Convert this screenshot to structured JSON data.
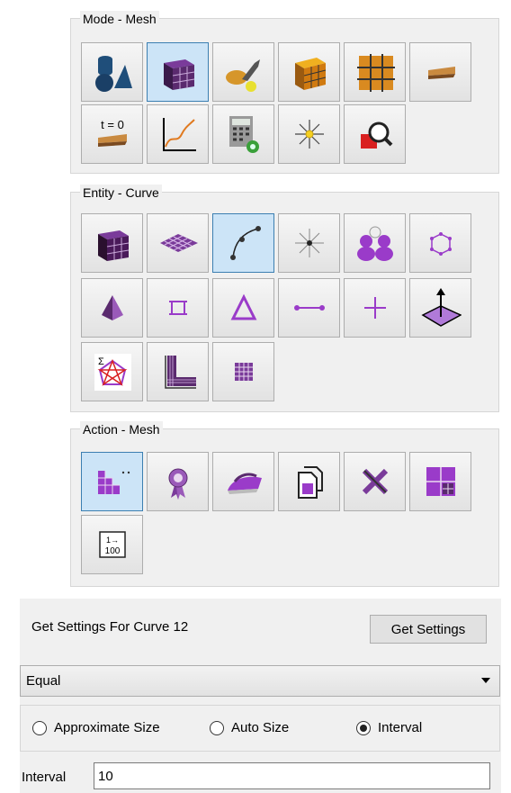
{
  "mode_group": {
    "title": "Mode - Mesh",
    "buttons": [
      {
        "icon": "geometry-icon"
      },
      {
        "icon": "mesh-cube-icon",
        "selected": true
      },
      {
        "icon": "boundary-conditions-icon"
      },
      {
        "icon": "material-cube-icon"
      },
      {
        "icon": "grid-icon"
      },
      {
        "icon": "analysis-icon"
      },
      {
        "icon": "initial-condition-icon",
        "label": "t = 0"
      },
      {
        "icon": "graph-icon"
      },
      {
        "icon": "calculator-icon"
      },
      {
        "icon": "sparkle-icon"
      },
      {
        "icon": "magnify-icon"
      }
    ]
  },
  "entity_group": {
    "title": "Entity - Curve",
    "buttons": [
      {
        "icon": "volume-icon"
      },
      {
        "icon": "surface-icon"
      },
      {
        "icon": "curve-icon",
        "selected": true
      },
      {
        "icon": "vertex-icon"
      },
      {
        "icon": "group-icon"
      },
      {
        "icon": "node-set-icon"
      },
      {
        "icon": "tet-icon"
      },
      {
        "icon": "quad-icon"
      },
      {
        "icon": "tri-icon"
      },
      {
        "icon": "edge-icon"
      },
      {
        "icon": "node-icon"
      },
      {
        "icon": "sideset-icon"
      },
      {
        "icon": "sum-icon"
      },
      {
        "icon": "boundary-layer-icon"
      },
      {
        "icon": "mesh-grid-icon"
      }
    ]
  },
  "action_group": {
    "title": "Action - Mesh",
    "buttons": [
      {
        "icon": "intervals-icon",
        "selected": true
      },
      {
        "icon": "quality-icon"
      },
      {
        "icon": "smooth-icon"
      },
      {
        "icon": "copy-icon"
      },
      {
        "icon": "delete-icon"
      },
      {
        "icon": "refine-icon"
      },
      {
        "icon": "renumber-icon",
        "label": "1→ 100"
      }
    ]
  },
  "get_settings": {
    "label": "Get Settings For Curve 12",
    "button": "Get Settings"
  },
  "scheme": {
    "value": "Equal"
  },
  "radios": [
    {
      "label": "Approximate Size",
      "checked": false
    },
    {
      "label": "Auto Size",
      "checked": false
    },
    {
      "label": "Interval",
      "checked": true
    }
  ],
  "interval": {
    "label": "Interval",
    "value": "10"
  }
}
